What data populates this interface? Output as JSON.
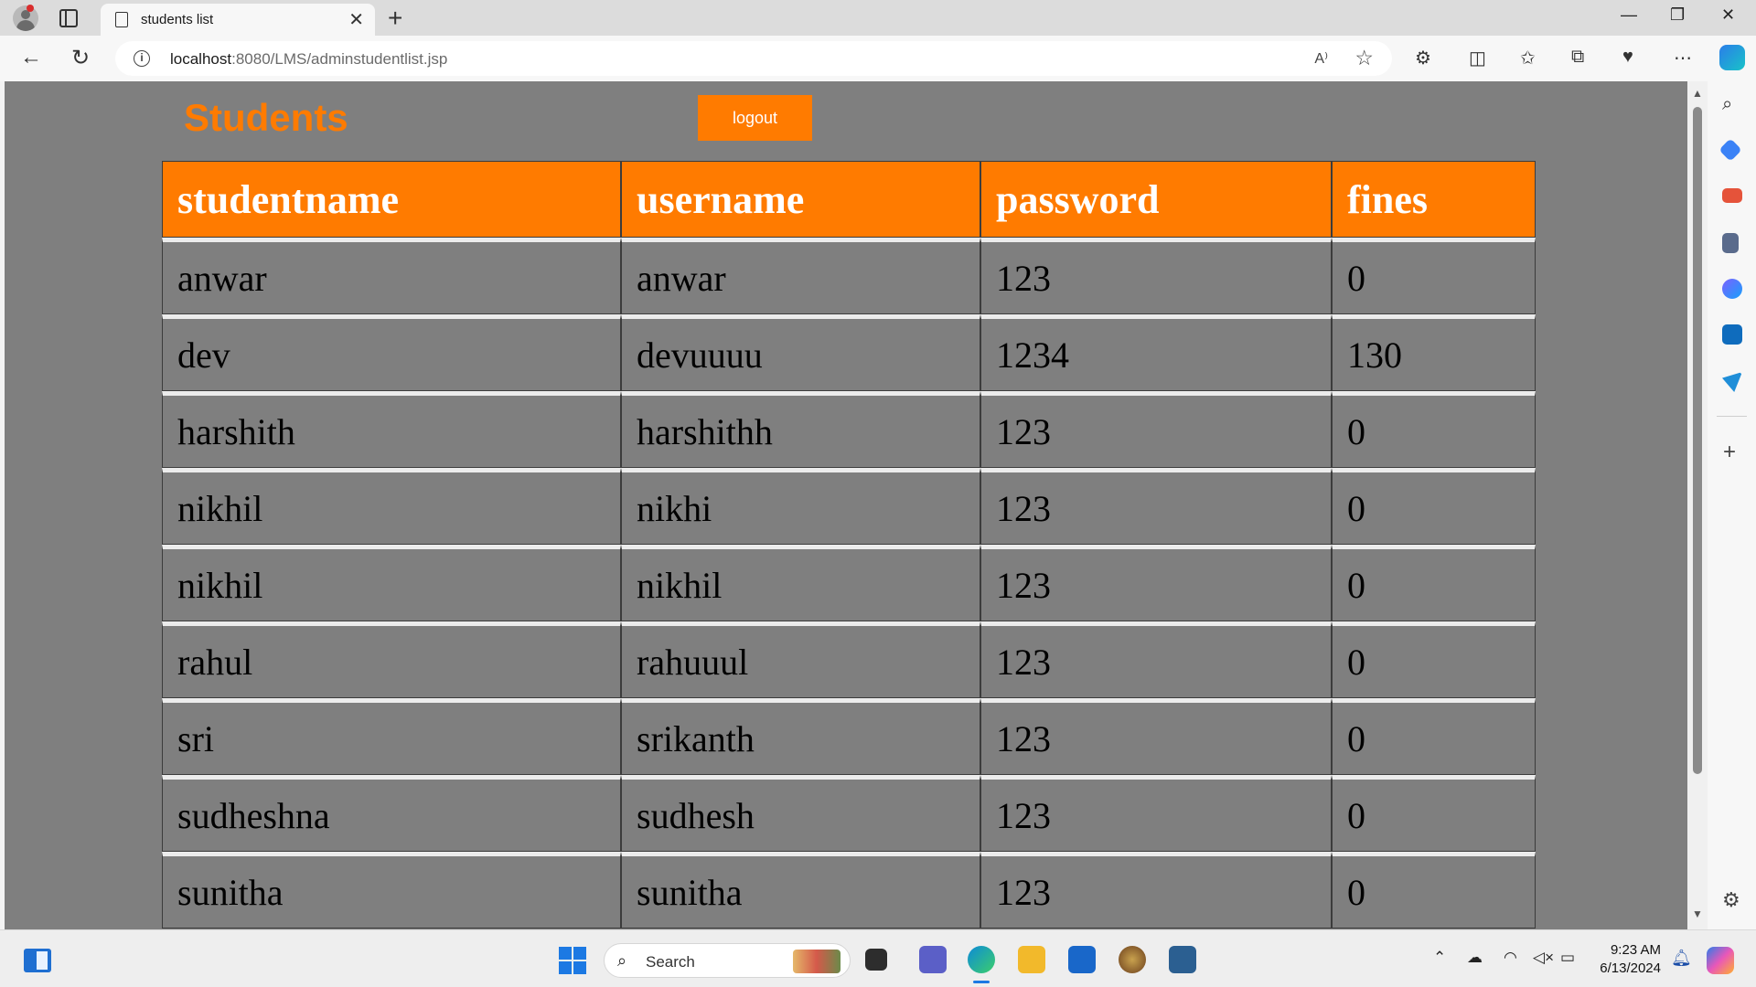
{
  "browser": {
    "tab_title": "students list",
    "url_host": "localhost",
    "url_rest": ":8080/LMS/adminstudentlist.jsp"
  },
  "page": {
    "heading": "Students",
    "logout_label": "logout"
  },
  "table": {
    "headers": [
      "studentname",
      "username",
      "password",
      "fines"
    ],
    "rows": [
      [
        "anwar",
        "anwar",
        "123",
        "0"
      ],
      [
        "dev",
        "devuuuu",
        "1234",
        "130"
      ],
      [
        "harshith",
        "harshithh",
        "123",
        "0"
      ],
      [
        "nikhil",
        "nikhi",
        "123",
        "0"
      ],
      [
        "nikhil",
        "nikhil",
        "123",
        "0"
      ],
      [
        "rahul",
        "rahuuul",
        "123",
        "0"
      ],
      [
        "sri",
        "srikanth",
        "123",
        "0"
      ],
      [
        "sudheshna",
        "sudhesh",
        "123",
        "0"
      ],
      [
        "sunitha",
        "sunitha",
        "123",
        "0"
      ]
    ]
  },
  "taskbar": {
    "search_label": "Search",
    "time": "9:23 AM",
    "date": "6/13/2024"
  },
  "colors": {
    "accent": "#ff7b00",
    "page_background": "#7f7f7f",
    "header_text": "#ffffff"
  },
  "icons": {
    "back": "back-arrow-icon",
    "refresh": "refresh-icon",
    "info": "info-icon",
    "favorite": "star-icon",
    "search": "search-icon",
    "settings": "gear-icon"
  }
}
